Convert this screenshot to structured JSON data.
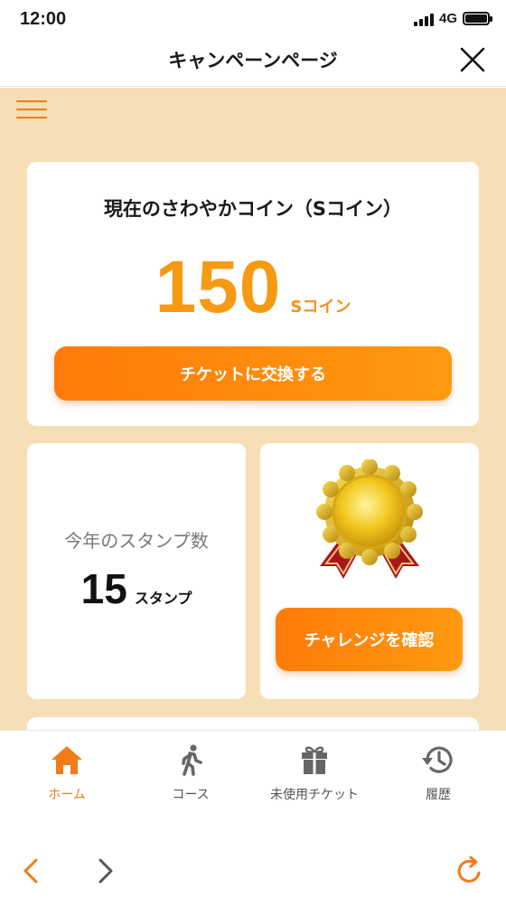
{
  "status_bar": {
    "time": "12:00",
    "network": "4G"
  },
  "header": {
    "title": "キャンペーンページ"
  },
  "coin_card": {
    "heading": "現在のさわやかコイン（Sコイン）",
    "amount": "150",
    "unit": "Sコイン",
    "button_label": "チケットに交換する"
  },
  "stamp_card": {
    "label": "今年のスタンプ数",
    "count": "15",
    "unit": "スタンプ"
  },
  "challenge_card": {
    "button_label": "チャレンジを確認"
  },
  "bottom_nav": {
    "items": [
      {
        "label": "ホーム",
        "icon": "home-icon",
        "active": true
      },
      {
        "label": "コース",
        "icon": "walking-icon",
        "active": false
      },
      {
        "label": "未使用チケット",
        "icon": "gift-icon",
        "active": false
      },
      {
        "label": "履歴",
        "icon": "history-icon",
        "active": false
      }
    ]
  },
  "colors": {
    "accent": "#f07b1a",
    "background": "#f6dfb7",
    "coin": "#f59a12"
  }
}
